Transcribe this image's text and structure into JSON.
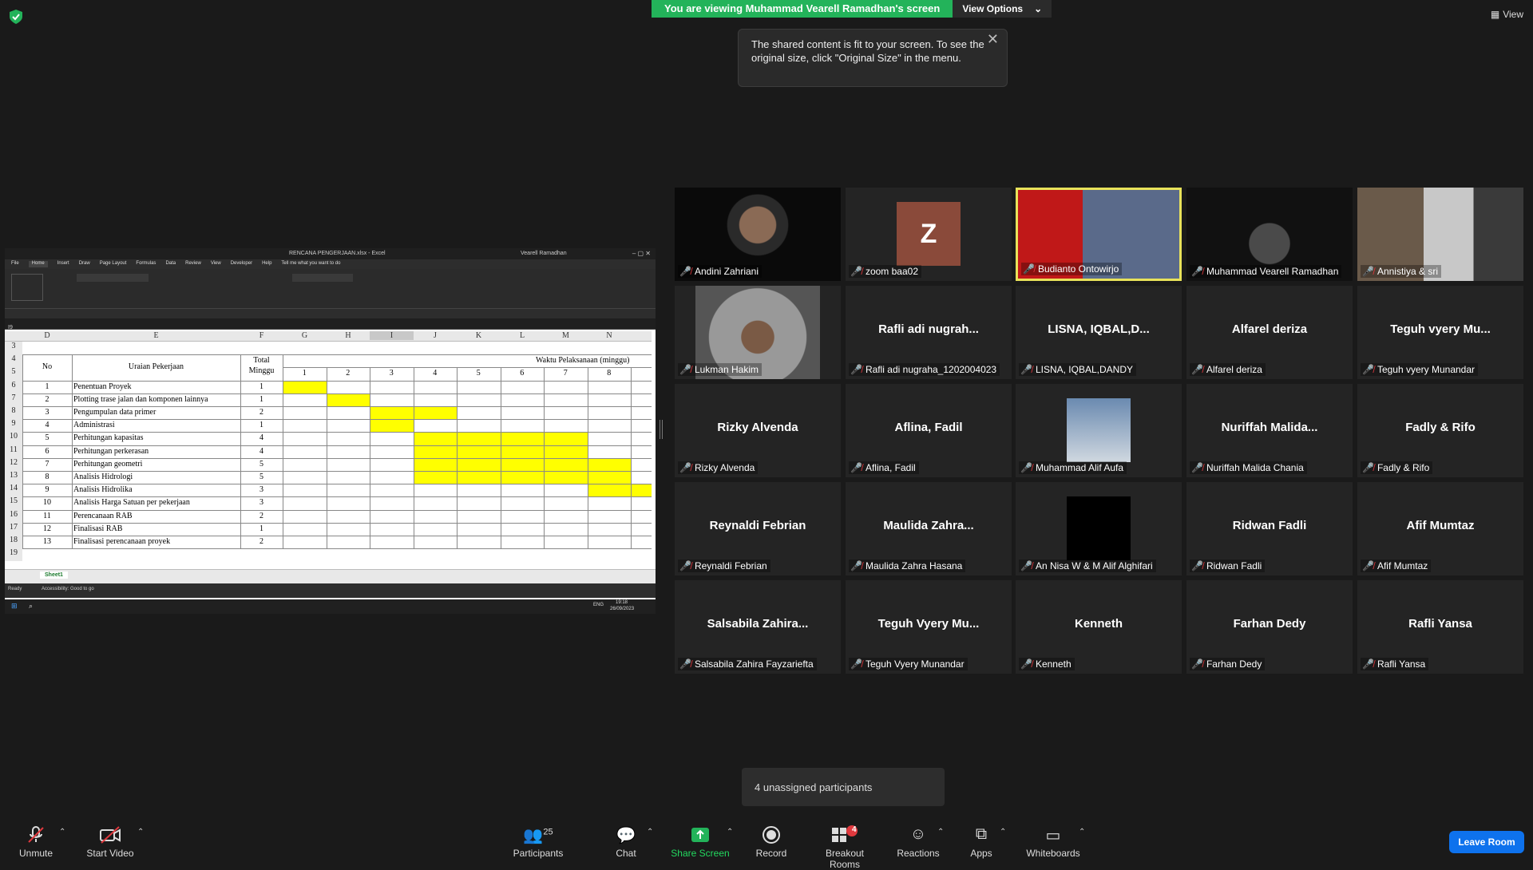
{
  "banner": {
    "viewing": "You are viewing Muhammad Vearell Ramadhan's screen",
    "options": "View Options"
  },
  "tooltip": {
    "text": "The shared content is fit to your screen. To see the original size, click \"Original Size\" in the menu."
  },
  "view_label": "View",
  "shared": {
    "window_title": "RENCANA PENGERJAAN.xlsx - Excel",
    "user": "Vearell Ramadhan",
    "menu": [
      "File",
      "Home",
      "Insert",
      "Draw",
      "Page Layout",
      "Formulas",
      "Data",
      "Review",
      "View",
      "Developer",
      "Help",
      "Tell me what you want to do"
    ],
    "name_box": "I9",
    "columns": [
      "D",
      "E",
      "F",
      "G",
      "H",
      "I",
      "J",
      "K",
      "L",
      "M",
      "N"
    ],
    "header_no": "No",
    "header_task": "Uraian Pekerjaan",
    "header_total": "Total Minggu",
    "header_time": "Waktu Pelaksanaan (minggu)",
    "weeks": [
      "1",
      "2",
      "3",
      "4",
      "5",
      "6",
      "7",
      "8"
    ],
    "row_numbers": [
      "3",
      "4",
      "5",
      "6",
      "7",
      "8",
      "9",
      "10",
      "11",
      "12",
      "13",
      "14",
      "15",
      "16",
      "17",
      "18",
      "19"
    ],
    "rows": [
      {
        "no": "1",
        "task": "Penentuan Proyek",
        "total": "1",
        "start": 1,
        "dur": 1
      },
      {
        "no": "2",
        "task": "Plotting trase jalan dan komponen lainnya",
        "total": "1",
        "start": 2,
        "dur": 1
      },
      {
        "no": "3",
        "task": "Pengumpulan data primer",
        "total": "2",
        "start": 3,
        "dur": 2
      },
      {
        "no": "4",
        "task": "Administrasi",
        "total": "1",
        "start": 3,
        "dur": 1
      },
      {
        "no": "5",
        "task": "Perhitungan kapasitas",
        "total": "4",
        "start": 4,
        "dur": 4
      },
      {
        "no": "6",
        "task": "Perhitungan perkerasan",
        "total": "4",
        "start": 4,
        "dur": 4
      },
      {
        "no": "7",
        "task": "Perhitungan geometri",
        "total": "5",
        "start": 4,
        "dur": 5
      },
      {
        "no": "8",
        "task": "Analisis Hidrologi",
        "total": "5",
        "start": 4,
        "dur": 5
      },
      {
        "no": "9",
        "task": "Analisis Hidrolika",
        "total": "3",
        "start": 8,
        "dur": 2
      },
      {
        "no": "10",
        "task": "Analisis Harga Satuan per pekerjaan",
        "total": "3",
        "start": 0,
        "dur": 0
      },
      {
        "no": "11",
        "task": "Perencanaan RAB",
        "total": "2",
        "start": 0,
        "dur": 0
      },
      {
        "no": "12",
        "task": "Finalisasi RAB",
        "total": "1",
        "start": 0,
        "dur": 0
      },
      {
        "no": "13",
        "task": "Finalisasi perencanaan proyek",
        "total": "2",
        "start": 0,
        "dur": 0
      }
    ],
    "sheet_tab": "Sheet1",
    "status_ready": "Ready",
    "accessibility": "Accessibility: Good to go",
    "clock_time": "19:18",
    "clock_date": "26/09/2023",
    "lang": "ENG"
  },
  "participants": [
    {
      "name": "Andini Zahriani",
      "center": "",
      "video": "person"
    },
    {
      "name": "zoom baa02",
      "center": "",
      "video": "avatar",
      "avatar_letter": "Z"
    },
    {
      "name": "Budianto Ontowirjo",
      "center": "",
      "video": "bakrie",
      "active": true
    },
    {
      "name": "Muhammad Vearell Ramadhan",
      "center": "",
      "video": "dark"
    },
    {
      "name": "Annistiya & sri",
      "center": "",
      "video": "room"
    },
    {
      "name": "Lukman Hakim",
      "center": "",
      "video": "lukman"
    },
    {
      "name": "Rafli adi nugraha_1202004023",
      "center": "Rafli adi nugrah..."
    },
    {
      "name": "LISNA, IQBAL,DANDY",
      "center": "LISNA, IQBAL,D..."
    },
    {
      "name": "Alfarel deriza",
      "center": "Alfarel deriza"
    },
    {
      "name": "Teguh vyery Munandar",
      "center": "Teguh vyery Mu..."
    },
    {
      "name": "Rizky Alvenda",
      "center": "Rizky Alvenda"
    },
    {
      "name": "Aflina, Fadil",
      "center": "Aflina, Fadil"
    },
    {
      "name": "Muhammad Alif Aufa",
      "center": "",
      "video": "alif"
    },
    {
      "name": "Nuriffah Malida Chania",
      "center": "Nuriffah  Malida..."
    },
    {
      "name": "Fadly & Rifo",
      "center": "Fadly & Rifo"
    },
    {
      "name": "Reynaldi Febrian",
      "center": "Reynaldi Febrian"
    },
    {
      "name": "Maulida Zahra Hasana",
      "center": "Maulida  Zahra..."
    },
    {
      "name": "An Nisa W & M Alif Alghifari",
      "center": "",
      "video": "black"
    },
    {
      "name": "Ridwan Fadli",
      "center": "Ridwan Fadli"
    },
    {
      "name": "Afif Mumtaz",
      "center": "Afif Mumtaz"
    },
    {
      "name": "Salsabila Zahira Fayzariefta",
      "center": "Salsabila  Zahira..."
    },
    {
      "name": "Teguh Vyery Munandar",
      "center": "Teguh Vyery Mu..."
    },
    {
      "name": "Kenneth",
      "center": "Kenneth"
    },
    {
      "name": "Farhan Dedy",
      "center": "Farhan Dedy"
    },
    {
      "name": "Rafli Yansa",
      "center": "Rafli Yansa"
    }
  ],
  "unassigned": "4 unassigned participants",
  "toolbar": {
    "unmute": "Unmute",
    "start_video": "Start Video",
    "participants": "Participants",
    "participants_count": "25",
    "chat": "Chat",
    "share_screen": "Share Screen",
    "record": "Record",
    "breakout": "Breakout Rooms",
    "breakout_count": "4",
    "reactions": "Reactions",
    "apps": "Apps",
    "whiteboards": "Whiteboards",
    "leave": "Leave Room"
  },
  "colors": {
    "zoom_green": "#23b35a",
    "leave_blue": "#0e72ed",
    "active_speaker": "#e8e25a",
    "gantt_yellow": "#ffff00",
    "muted_red": "#e0393e"
  }
}
